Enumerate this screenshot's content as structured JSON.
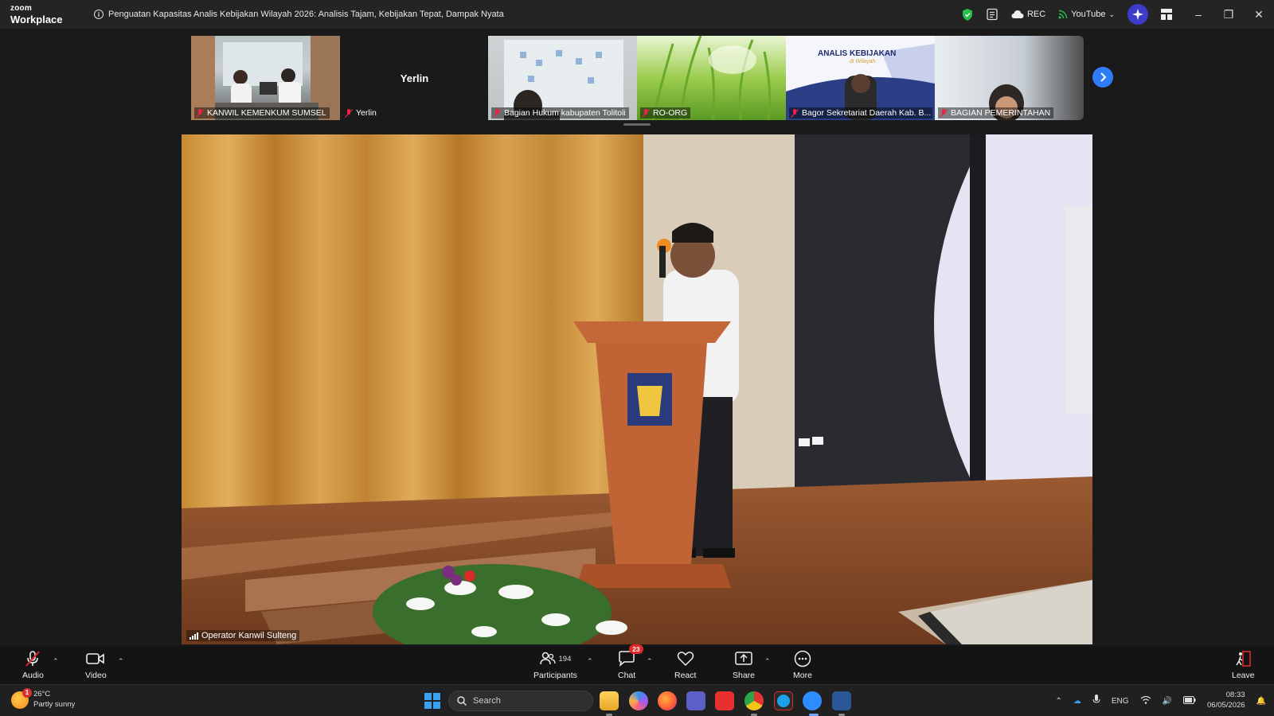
{
  "app": {
    "brand_top": "zoom",
    "brand_bottom": "Workplace"
  },
  "meeting": {
    "title": "Penguatan Kapasitas Analis Kebijakan Wilayah 2026: Analisis Tajam, Kebijakan Tepat, Dampak Nyata"
  },
  "titlebar": {
    "rec_label": "REC",
    "stream_label": "YouTube"
  },
  "participants_strip": [
    {
      "name": "KANWIL KEMENKUM SUMSEL",
      "video": true
    },
    {
      "name": "Yerlin",
      "video": false
    },
    {
      "name": "Bagian Hukum kabupaten Tolitoli",
      "video": true
    },
    {
      "name": "RO-ORG",
      "video": true
    },
    {
      "name": "Bagor Sekretariat Daerah Kab. B...",
      "video": true
    },
    {
      "name": "BAGIAN PEMERINTAHAN",
      "video": true
    }
  ],
  "slide_thumb": {
    "heading": "ANALIS KEBIJAKAN",
    "sub": "di Wilayah"
  },
  "speaker": {
    "name": "Operator Kanwil Sulteng"
  },
  "toolbar": {
    "audio": "Audio",
    "video": "Video",
    "participants": "Participants",
    "participant_count": "194",
    "chat": "Chat",
    "chat_badge": "23",
    "react": "React",
    "share": "Share",
    "more": "More",
    "leave": "Leave"
  },
  "taskbar": {
    "weather_temp": "26°C",
    "weather_desc": "Partly sunny",
    "weather_badge": "1",
    "search_placeholder": "Search",
    "lang": "ENG",
    "time": "08:33",
    "date": "06/05/2026"
  },
  "colors": {
    "accent": "#2e7cf6",
    "titlebar": "#242424",
    "toolbar": "#141414",
    "danger": "#e02828"
  }
}
